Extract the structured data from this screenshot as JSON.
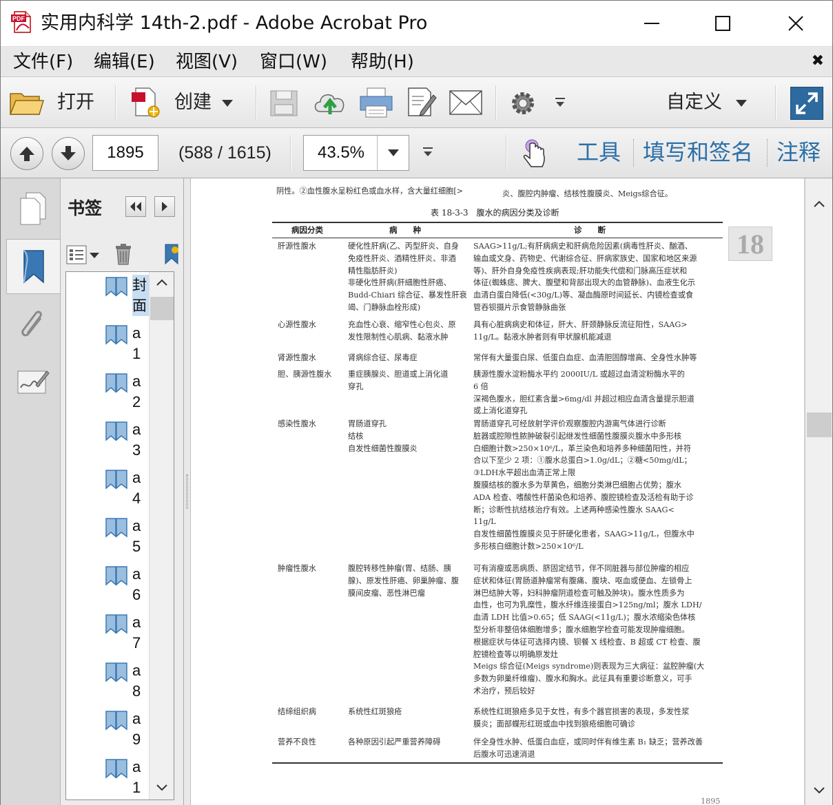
{
  "window": {
    "title": "实用内科学 14th-2.pdf - Adobe Acrobat Pro"
  },
  "menu": {
    "items": [
      "文件(F)",
      "编辑(E)",
      "视图(V)",
      "窗口(W)",
      "帮助(H)"
    ]
  },
  "toolbar": {
    "open_label": "打开",
    "create_label": "创建",
    "customize_label": "自定义"
  },
  "nav": {
    "page_number": "1895",
    "page_count": "(588 / 1615)",
    "zoom": "43.5%"
  },
  "panes": {
    "tools": "工具",
    "fill_sign": "填写和签名",
    "comment": "注释"
  },
  "bookmarks": {
    "title": "书签",
    "items": [
      "封面",
      "a1",
      "a2",
      "a3",
      "a4",
      "a5",
      "a6",
      "a7",
      "a8",
      "a9",
      "a1"
    ]
  },
  "document": {
    "top_left": "阴性。②血性腹水呈粉红色或血水样，含大量红细胞[>",
    "top_right": "炎、腹腔内肿瘤、结核性腹膜炎、Meigs综合征。",
    "table_title": "表 18-3-3　腹水的病因分类及诊断",
    "chapter_number": "18",
    "headers": [
      "病因分类",
      "病　　种",
      "诊　　断"
    ],
    "rows": [
      {
        "category": "肝源性腹水",
        "disease": [
          "硬化性肝病(乙、丙型肝炎、自身",
          "免疫性肝炎、酒精性肝炎、非酒",
          "精性脂肪肝炎)",
          "非硬化性肝病(肝細胞性肝癌、",
          "Budd-Chiari 综合征、暴发性肝衰",
          "竭、门静脉血栓形成)"
        ],
        "diagnosis": [
          "SAAG>11g/L;有肝病病史和肝病危险因素(病毒性肝炎、酗酒、",
          "输血或文身、药物史、代谢综合征、肝病家族史、国家和地区来源",
          "等)、肝外自身免疫性疾病表现;肝功能失代偿和门脉高压症状和",
          "体征(蜘蛛痣、脾大、腹壁和背部出现大的血管静脉)、血液生化示",
          "血清白蛋白降低(<30g/L)等、凝血酶原时间延长、内镜检查或食",
          "管吞钡摄片示食管静脉曲张"
        ]
      },
      {
        "category": "心源性腹水",
        "disease": [
          "充血性心衰、缩窄性心包炎、原",
          "发性限制性心肌病、黏液水肿"
        ],
        "diagnosis": [
          "具有心脏病病史和体征，肝大、肝颈静脉反流征阳性，SAAG>",
          "11g/L。黏液水肿者则有甲状腺机能减退"
        ]
      },
      {
        "category": "肾源性腹水",
        "disease": [
          "肾病综合征、尿毒症"
        ],
        "diagnosis": [
          "常伴有大量蛋白尿、低蛋白血症、血清胆固醇增高、全身性水肿等"
        ]
      },
      {
        "category": "胆、胰源性腹水",
        "disease": [
          "重症胰腺炎、胆道或上消化道",
          "穿孔"
        ],
        "diagnosis": [
          "胰源性腹水淀粉酶水平约 2000IU/L 或超过血清淀粉酶水平的",
          "6 倍",
          "深褐色腹水，胆红素含量>6mg/dl 并超过相应血清含量提示胆道",
          "或上消化道穿孔"
        ]
      },
      {
        "category": "感染性腹水",
        "disease": [
          "胃肠道穿孔",
          "结核",
          "自发性细菌性腹膜炎"
        ],
        "diagnosis": [
          "胃肠道穿孔可经放射学评价观察腹腔内游离气体进行诊断",
          "脏器或腔隙性脓肿破裂引起继发性细菌性腹膜炎腹水中多形核",
          "白细胞计数>250×10⁶/L，革兰染色和培养多种细菌阳性，并符",
          "合以下至少 2 项：①腹水总蛋白>1.0g/dL；②糖<50mg/dL；",
          "③LDH水平超出血清正常上限",
          "腹膜结核的腹水多为草黄色，细胞分类淋巴细胞占优势；腹水",
          "ADA 检查、嗜酸性杆菌染色和培养、腹腔镜检查及活检有助于诊",
          "断；诊断性抗结核治疗有效。上述两种感染性腹水 SAAG<",
          "11g/L",
          "自发性细菌性腹膜炎见于肝硬化患者，SAAG>11g/L，但腹水中",
          "多形核白细胞计数>250×10⁶/L"
        ]
      },
      {
        "category": "肿瘤性腹水",
        "disease": [
          "腹腔转移性肿瘤(胃、结肠、胰",
          "腺)、原发性肝癌、卵巢肿瘤、腹",
          "膜间皮瘤、恶性淋巴瘤"
        ],
        "diagnosis": [
          "可有消瘦或恶病质、脐固定结节，伴不同脏器与部位肿瘤的相应",
          "症状和体征(胃肠道肿瘤常有腹痛、腹块、呕血或便血、左锁骨上",
          "淋巴结肿大等，妇科肿瘤阴道检查可触及肿块)。腹水性质多为",
          "血性，也可为乳糜性，腹水纤维连接蛋白>125ng/ml；腹水 LDH/",
          "血清 LDH 比值>0.65；低 SAAG(<11g/L)；腹水浓缩染色体核",
          "型分析非整倍体细胞增多；腹水细胞学检查可能发现肿瘤细胞。",
          "根据症状与体征可选择内镜、钡餐 X 线检查、B 超或 CT 检查、腹",
          "腔镜检查等以明确原发灶",
          "Meigs 综合征(Meigs syndrome)则表现为三大病征：盆腔肿瘤(大",
          "多数为卵巢纤维瘤)、腹水和胸水。此征具有重要诊断意义，可手",
          "术治疗，预后较好"
        ]
      },
      {
        "category": "结缔组织病",
        "disease": [
          "系统性红斑狼疮"
        ],
        "diagnosis": [
          "系统性红斑狼疮多见于女性，有多个器官损害的表现，多发性浆",
          "膜炎；面部蝶形红斑或血中找到狼疮细胞可确诊"
        ]
      },
      {
        "category": "营养不良性",
        "disease": [
          "各种原因引起严重营养障碍"
        ],
        "diagnosis": [
          "伴全身性水肿、低蛋白血症，或同时伴有维生素 B₁ 缺乏；营养改善",
          "后腹水可迅速消退"
        ]
      }
    ],
    "footer_page": "1895"
  }
}
